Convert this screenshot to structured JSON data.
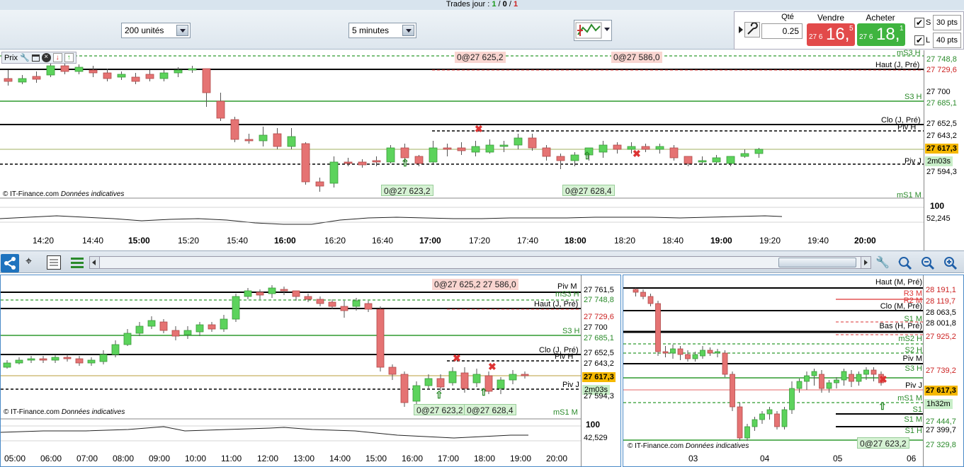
{
  "topbar": {
    "label": "Trades jour :",
    "v1": "1",
    "sep1": "/",
    "v2": "0",
    "sep2": "/",
    "v3": "1"
  },
  "toolbar": {
    "units": "200 unités",
    "interval": "5 minutes",
    "qty_label": "Qté",
    "qty_value": "0.25",
    "sell_label": "Vendre",
    "buy_label": "Acheter",
    "sell_small": "27 6",
    "sell_big": "16,",
    "sell_sup": "5",
    "buy_small": "27 6",
    "buy_big": "18,",
    "buy_sup": "1",
    "s_label": "S",
    "l_label": "L",
    "s_pts": "30 pts",
    "l_pts": "40 pts"
  },
  "colors": {
    "up": "#5cd35c",
    "down": "#e57373",
    "green_line": "#2e9a2e",
    "red_line": "#d33",
    "accent": "#1e73be"
  },
  "top_chart": {
    "title": "Prix",
    "level_labels": {
      "ms3h": "mS3 H",
      "haut": "Haut (J, Pré)",
      "s3h": "S3 H",
      "clo": "Clo (J, Pré)",
      "pivh": "Piv H",
      "pivj": "Piv J",
      "ms1m": "mS1 M"
    },
    "axis": [
      "27 748,8",
      "27 729,6",
      "27 700",
      "27 685,1",
      "27 652,5",
      "27 643,2",
      "27 617,3",
      "2m03s",
      "27 594,3"
    ],
    "tags": [
      "0@27 625,2",
      "0@27 586,0",
      "0@27 623,2",
      "0@27 628,4"
    ],
    "osc_axis": [
      "100",
      "52,245"
    ],
    "copyright": "© IT-Finance.com",
    "copyright_note": "Données indicatives",
    "times": [
      "14:20",
      "14:40",
      "15:00",
      "15:20",
      "15:40",
      "16:00",
      "16:20",
      "16:40",
      "17:00",
      "17:20",
      "17:40",
      "18:00",
      "18:20",
      "18:40",
      "19:00",
      "19:20",
      "19:40",
      "20:00"
    ]
  },
  "bottom_left": {
    "level_labels": {
      "pivm": "Piv M",
      "ms3h": "mS3 H",
      "haut": "Haut (J, Pré)",
      "s3h": "S3 H",
      "clo": "Clo (J, Pré)",
      "pivh": "Piv H",
      "pivj": "Piv J",
      "ms1m": "mS1 M"
    },
    "axis": [
      "27 761,5",
      "27 748,8",
      "27 729,6",
      "27 700",
      "27 685,1",
      "27 652,5",
      "27 643,2",
      "27 617,3",
      "2m03s",
      "27 594,3"
    ],
    "tags": [
      "0@27 625,2 27 586,0",
      "0@27 623,2",
      "0@27 628,4"
    ],
    "osc_axis": [
      "100",
      "42,529"
    ],
    "copyright": "© IT-Finance.com",
    "copyright_note": "Données indicatives",
    "times": [
      "05:00",
      "06:00",
      "07:00",
      "08:00",
      "09:00",
      "10:00",
      "11:00",
      "12:00",
      "13:00",
      "14:00",
      "15:00",
      "16:00",
      "17:00",
      "18:00",
      "19:00",
      "20:00"
    ]
  },
  "bottom_right": {
    "level_labels": [
      "Haut (M, Pré)",
      "R3 M",
      "R2 M",
      "Clo (M, Pré)",
      "S1 M",
      "Bas (H, Pré)",
      "mS2 H",
      "S2 H",
      "Piv M",
      "S3 H",
      "Piv J",
      "mS1 M",
      "S1",
      "S1 M",
      "S1 H"
    ],
    "axis": [
      "28 191,1",
      "28 119,7",
      "28 063,5",
      "28 001,8",
      "27 925,2",
      "27 739,2",
      "27 617,3",
      "1h32m",
      "27 444,7",
      "27 399,7",
      "27 329,8"
    ],
    "tag": "0@27 623,2",
    "copyright": "© IT-Finance.com",
    "copyright_note": "Données indicatives",
    "times": [
      "03",
      "04",
      "05",
      "06"
    ]
  }
}
